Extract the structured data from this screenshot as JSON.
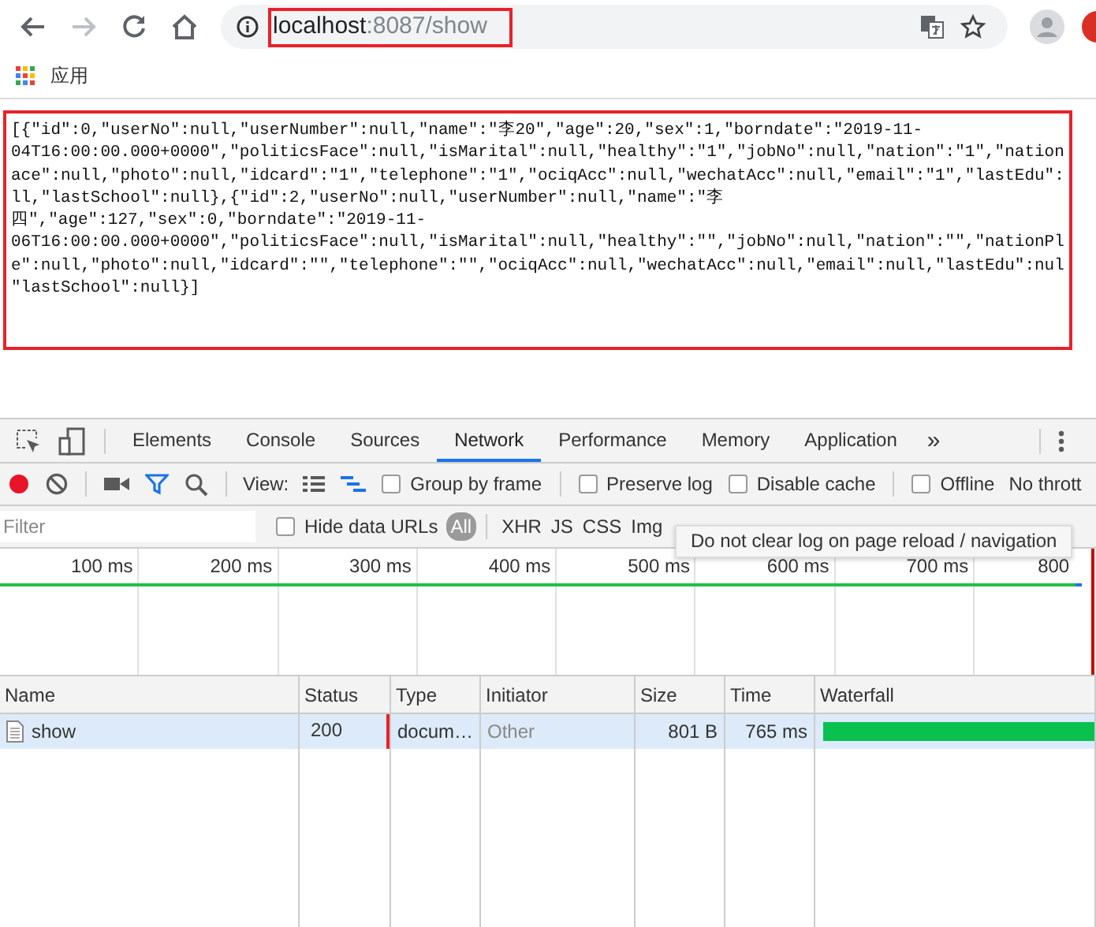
{
  "browser": {
    "back_enabled": true,
    "forward_enabled": false,
    "url_host": "localhost",
    "url_rest": ":8087/show"
  },
  "bookmarks": [
    {
      "label": "应用"
    }
  ],
  "page": {
    "lines": [
      "[{\"id\":0,\"userNo\":null,\"userNumber\":null,\"name\":\"李20\",\"age\":20,\"sex\":1,\"borndate\":\"2019-11-",
      "04T16:00:00.000+0000\",\"politicsFace\":null,\"isMarital\":null,\"healthy\":\"1\",\"jobNo\":null,\"nation\":\"1\",\"nation",
      "ace\":null,\"photo\":null,\"idcard\":\"1\",\"telephone\":\"1\",\"ociqAcc\":null,\"wechatAcc\":null,\"email\":\"1\",\"lastEdu\":",
      "ll,\"lastSchool\":null},{\"id\":2,\"userNo\":null,\"userNumber\":null,\"name\":\"李",
      "四\",\"age\":127,\"sex\":0,\"borndate\":\"2019-11-",
      "06T16:00:00.000+0000\",\"politicsFace\":null,\"isMarital\":null,\"healthy\":\"\",\"jobNo\":null,\"nation\":\"\",\"nationPl",
      "e\":null,\"photo\":null,\"idcard\":\"\",\"telephone\":\"\",\"ociqAcc\":null,\"wechatAcc\":null,\"email\":null,\"lastEdu\":nul",
      "\"lastSchool\":null}]"
    ]
  },
  "devtools": {
    "tabs": [
      {
        "label": "Elements",
        "selected": false
      },
      {
        "label": "Console",
        "selected": false
      },
      {
        "label": "Sources",
        "selected": false
      },
      {
        "label": "Network",
        "selected": true
      },
      {
        "label": "Performance",
        "selected": false
      },
      {
        "label": "Memory",
        "selected": false
      },
      {
        "label": "Application",
        "selected": false
      }
    ],
    "more": "»",
    "toolbar": {
      "recording": true,
      "view_label": "View:",
      "checkboxes": [
        {
          "label": "Group by frame",
          "checked": false
        },
        {
          "label": "Preserve log",
          "checked": false
        },
        {
          "label": "Disable cache",
          "checked": false
        },
        {
          "label": "Offline",
          "checked": false
        }
      ],
      "throttling": "No thrott"
    },
    "filter": {
      "placeholder": "Filter",
      "hide_data_urls": {
        "label": "Hide data URLs",
        "checked": false
      },
      "types": [
        {
          "label": "All",
          "selected": true
        },
        {
          "label": "XHR",
          "selected": false
        },
        {
          "label": "JS",
          "selected": false
        },
        {
          "label": "CSS",
          "selected": false
        },
        {
          "label": "Img",
          "selected": false
        }
      ]
    },
    "tooltip": "Do not clear log on page reload / navigation",
    "timeline_ticks": [
      "100 ms",
      "200 ms",
      "300 ms",
      "400 ms",
      "500 ms",
      "600 ms",
      "700 ms",
      "800"
    ],
    "table": {
      "columns": [
        "Name",
        "Status",
        "Type",
        "Initiator",
        "Size",
        "Time",
        "Waterfall"
      ],
      "rows": [
        {
          "name": "show",
          "status": "200",
          "type": "docum…",
          "initiator": "Other",
          "size": "801 B",
          "time": "765 ms",
          "selected": true
        }
      ]
    }
  }
}
